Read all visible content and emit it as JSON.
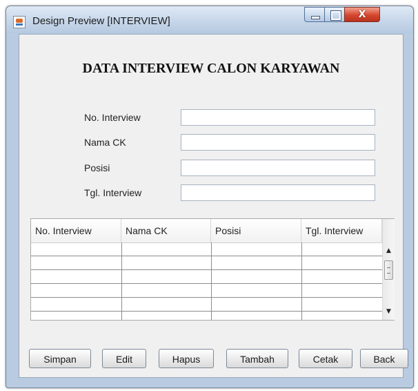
{
  "window": {
    "title": "Design Preview [INTERVIEW]",
    "close_glyph": "X"
  },
  "form": {
    "heading": "DATA INTERVIEW CALON KARYAWAN",
    "fields": [
      {
        "label": "No. Interview",
        "value": ""
      },
      {
        "label": "Nama CK",
        "value": ""
      },
      {
        "label": "Posisi",
        "value": ""
      },
      {
        "label": "Tgl. Interview",
        "value": ""
      }
    ]
  },
  "table": {
    "columns": [
      "No. Interview",
      "Nama CK",
      "Posisi",
      "Tgl. Interview"
    ],
    "rows": []
  },
  "buttons": [
    "Simpan",
    "Edit",
    "Hapus",
    "Tambah",
    "Cetak",
    "Back"
  ],
  "scrollbar": {
    "up_glyph": "▲",
    "down_glyph": "▼"
  }
}
